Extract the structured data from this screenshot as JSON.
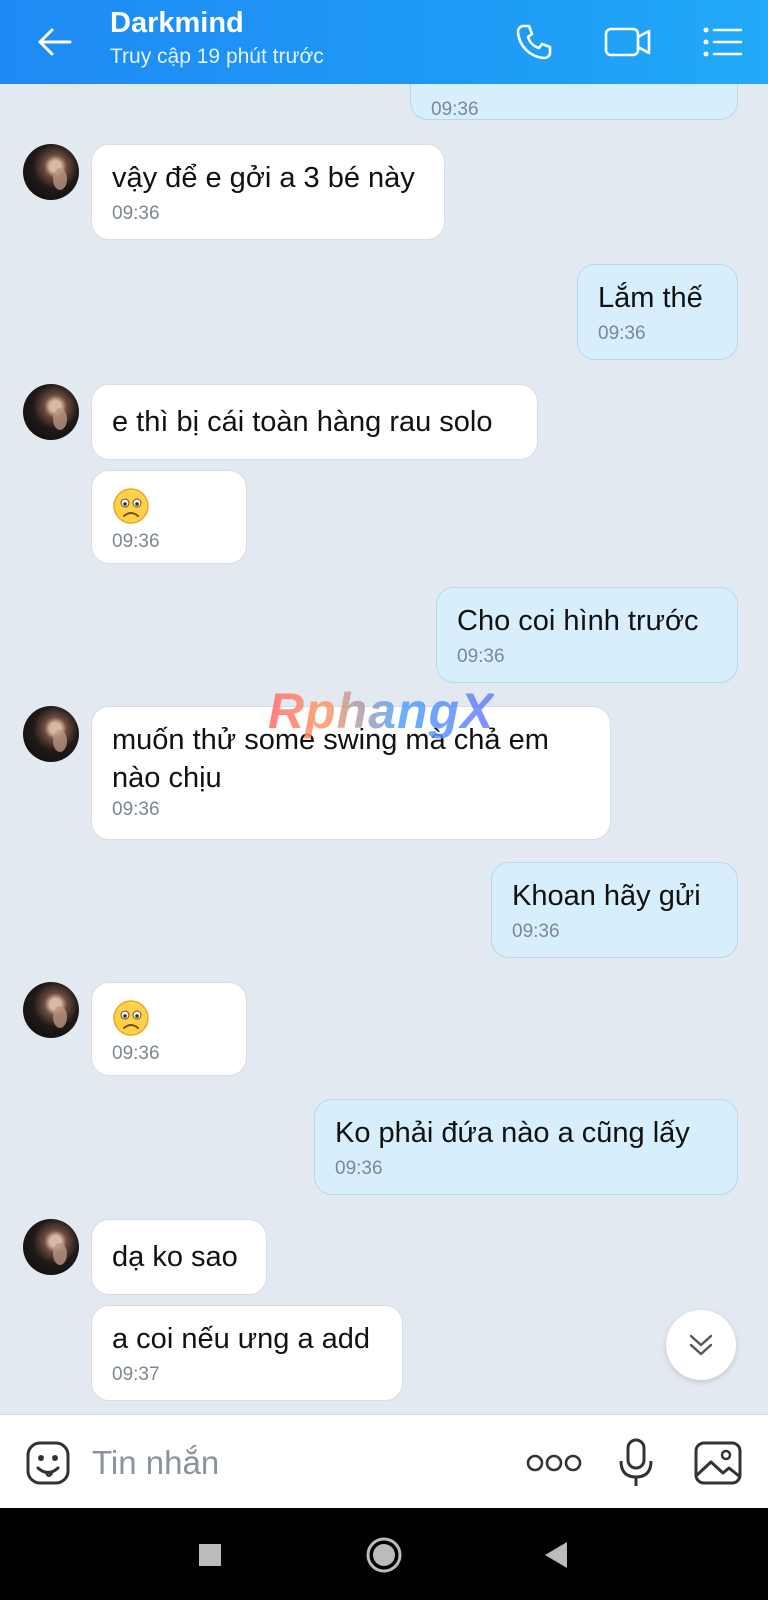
{
  "header": {
    "title": "Darkmind",
    "subtitle": "Truy cập 19 phút trước",
    "icons": [
      "back-arrow-icon",
      "phone-icon",
      "video-call-icon",
      "menu-list-icon"
    ]
  },
  "messages": [
    {
      "side": "out",
      "text": "",
      "time": "09:36"
    },
    {
      "side": "in",
      "text": "vậy để e gởi a 3 bé này",
      "time": "09:36"
    },
    {
      "side": "out",
      "text": "Lắm thế",
      "time": "09:36"
    },
    {
      "side": "in",
      "text": "e thì bị cái toàn hàng rau solo",
      "time": ""
    },
    {
      "side": "in",
      "emoji": "sad-face-emoji",
      "time": "09:36"
    },
    {
      "side": "out",
      "text": "Cho coi hình trước",
      "time": "09:36"
    },
    {
      "side": "in",
      "text": "muốn thử some swing mà chả em nào chịu",
      "time": "09:36"
    },
    {
      "side": "out",
      "text": "Khoan hãy gửi",
      "time": "09:36"
    },
    {
      "side": "in",
      "emoji": "sad-face-emoji",
      "time": "09:36"
    },
    {
      "side": "out",
      "text": "Ko phải đứa nào a cũng lấy",
      "time": "09:36"
    },
    {
      "side": "in",
      "text": "dạ ko sao",
      "time": ""
    },
    {
      "side": "in",
      "text": "a coi nếu ưng a add",
      "time": "09:37"
    }
  ],
  "watermark": "RphangX",
  "composer": {
    "placeholder": "Tin nhắn",
    "icons": [
      "sticker-face-icon",
      "more-dots-icon",
      "microphone-icon",
      "image-icon"
    ]
  },
  "navbar": {
    "icons": [
      "recent-apps-icon",
      "home-icon",
      "back-triangle-icon"
    ]
  },
  "colors": {
    "header": "#1f8af4",
    "background": "#e2e9f1",
    "incoming_bubble": "#ffffff",
    "outgoing_bubble": "#d7effd",
    "timestamp": "#7d8793"
  }
}
